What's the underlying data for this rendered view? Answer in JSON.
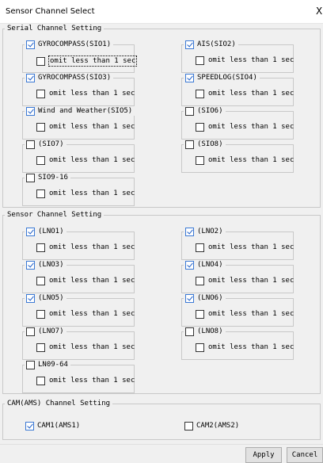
{
  "window": {
    "title": "Sensor Channel Select",
    "close_glyph": "X"
  },
  "serial": {
    "title": "Serial Channel Setting",
    "channels": [
      {
        "label": "GYROCOMPASS(SIO1)",
        "checked": true,
        "omit_label": "omit less than 1 sec",
        "omit_checked": false
      },
      {
        "label": "AIS(SIO2)",
        "checked": true,
        "omit_label": "omit less than 1 sec",
        "omit_checked": false
      },
      {
        "label": "GYROCOMPASS(SIO3)",
        "checked": true,
        "omit_label": "omit less than 1 sec",
        "omit_checked": false
      },
      {
        "label": "SPEEDLOG(SIO4)",
        "checked": true,
        "omit_label": "omit less than 1 sec",
        "omit_checked": false
      },
      {
        "label": "Wind and Weather(SIO5)",
        "checked": true,
        "omit_label": "omit less than 1 sec",
        "omit_checked": false
      },
      {
        "label": "(SIO6)",
        "checked": false,
        "omit_label": "omit less than 1 sec",
        "omit_checked": false
      },
      {
        "label": "(SIO7)",
        "checked": false,
        "omit_label": "omit less than 1 sec",
        "omit_checked": false
      },
      {
        "label": "(SIO8)",
        "checked": false,
        "omit_label": "omit less than 1 sec",
        "omit_checked": false
      },
      {
        "label": "SIO9-16",
        "checked": false,
        "omit_label": "omit less than 1 sec",
        "omit_checked": false
      }
    ]
  },
  "sensor": {
    "title": "Sensor Channel Setting",
    "channels": [
      {
        "label": "(LNO1)",
        "checked": true,
        "omit_label": "omit less than 1 sec",
        "omit_checked": false
      },
      {
        "label": "(LNO2)",
        "checked": true,
        "omit_label": "omit less than 1 sec",
        "omit_checked": false
      },
      {
        "label": "(LNO3)",
        "checked": true,
        "omit_label": "omit less than 1 sec",
        "omit_checked": false
      },
      {
        "label": "(LNO4)",
        "checked": true,
        "omit_label": "omit less than 1 sec",
        "omit_checked": false
      },
      {
        "label": "(LNO5)",
        "checked": true,
        "omit_label": "omit less than 1 sec",
        "omit_checked": false
      },
      {
        "label": "(LNO6)",
        "checked": true,
        "omit_label": "omit less than 1 sec",
        "omit_checked": false
      },
      {
        "label": "(LNO7)",
        "checked": false,
        "omit_label": "omit less than 1 sec",
        "omit_checked": false
      },
      {
        "label": "(LNO8)",
        "checked": false,
        "omit_label": "omit less than 1 sec",
        "omit_checked": false
      },
      {
        "label": "LN09-64",
        "checked": false,
        "omit_label": "omit less than 1 sec",
        "omit_checked": false
      }
    ]
  },
  "cam": {
    "title": "CAM(AMS) Channel Setting",
    "channels": [
      {
        "label": "CAM1(AMS1)",
        "checked": true
      },
      {
        "label": "CAM2(AMS2)",
        "checked": false
      }
    ]
  },
  "buttons": {
    "apply": "Apply",
    "cancel": "Cancel"
  }
}
